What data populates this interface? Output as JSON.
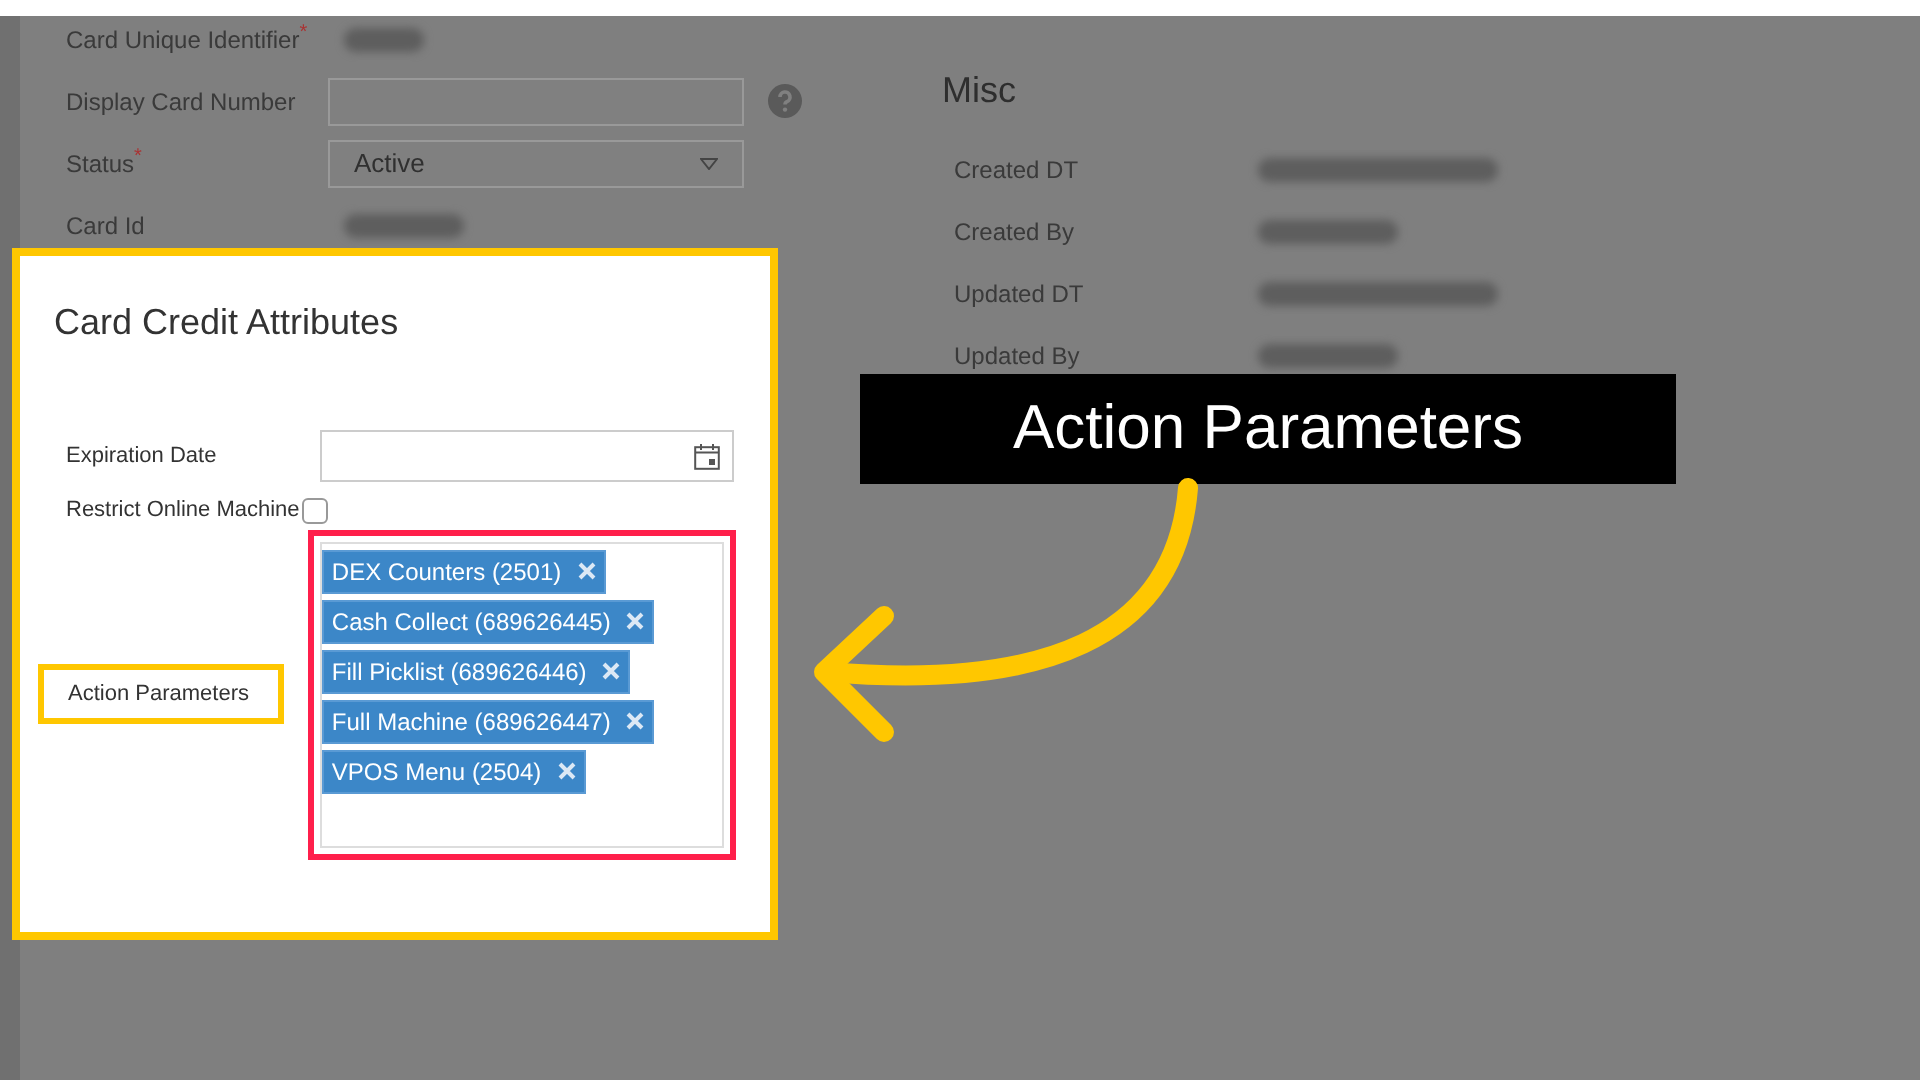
{
  "form": {
    "fields": [
      {
        "label": "Card Unique Identifier",
        "required_mark": "*",
        "kind": "blurred"
      },
      {
        "label": "Display Card Number",
        "kind": "input"
      },
      {
        "label": "Status",
        "required_mark": "*",
        "kind": "select",
        "value": "Active"
      },
      {
        "label": "Card Id",
        "kind": "blurred"
      }
    ]
  },
  "misc": {
    "title": "Misc",
    "fields": [
      {
        "label": "Created DT"
      },
      {
        "label": "Created By"
      },
      {
        "label": "Updated DT"
      },
      {
        "label": "Updated By"
      }
    ]
  },
  "card": {
    "title": "Card Credit Attributes",
    "expiration_date": {
      "label": "Expiration Date"
    },
    "restrict_online_machine": {
      "label": "Restrict Online Machine",
      "checked": false
    },
    "action_parameters": {
      "label": "Action Parameters",
      "tags": [
        "DEX Counters (2501)",
        "Cash Collect (689626445)",
        "Fill Picklist (689626446)",
        "Full Machine (689626447)",
        "VPOS Menu (2504)"
      ]
    }
  },
  "callout": {
    "text": "Action Parameters"
  }
}
